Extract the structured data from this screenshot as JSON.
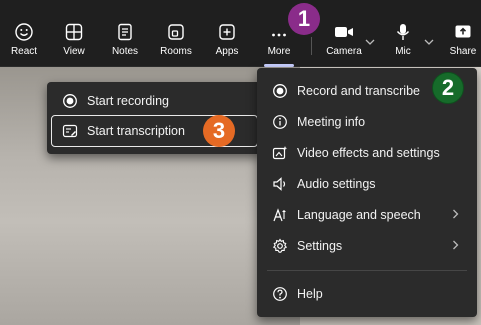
{
  "toolbar": {
    "react": "React",
    "view": "View",
    "notes": "Notes",
    "rooms": "Rooms",
    "apps": "Apps",
    "more": "More",
    "camera": "Camera",
    "mic": "Mic",
    "share": "Share"
  },
  "badges": {
    "one": "1",
    "two": "2",
    "three": "3"
  },
  "submenu": {
    "start_recording": "Start recording",
    "start_transcription": "Start transcription"
  },
  "main_menu": {
    "record_and_transcribe": "Record and transcribe",
    "meeting_info": "Meeting info",
    "video_effects": "Video effects and settings",
    "audio_settings": "Audio settings",
    "language_speech": "Language and speech",
    "settings": "Settings",
    "help": "Help"
  },
  "colors": {
    "badge_purple": "#8a2c8a",
    "badge_green": "#166b2a",
    "badge_orange": "#e56a24",
    "menu_bg": "#2b2b2b",
    "toolbar_bg": "#1f1f1f"
  }
}
